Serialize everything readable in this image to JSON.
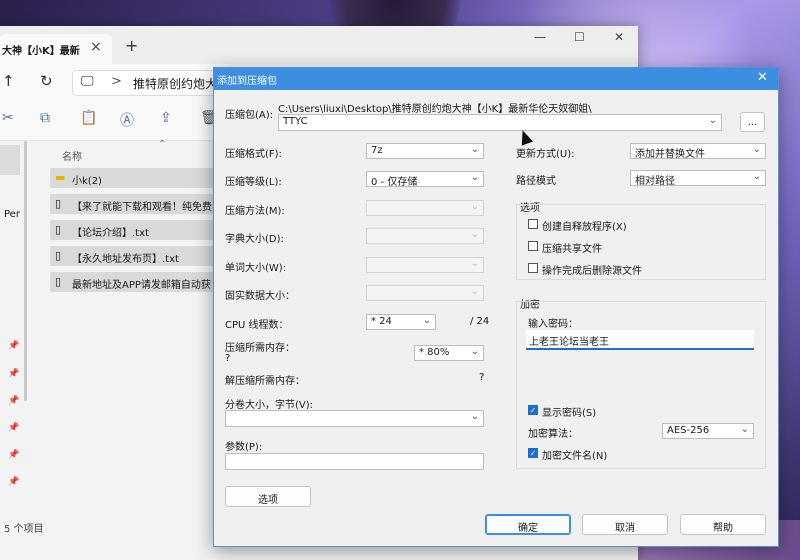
{
  "explorer": {
    "tab_title": "大神【小K】最新",
    "tab_close": "×",
    "new_tab": "+",
    "window_controls": [
      "—",
      "☐",
      "✕"
    ],
    "address_path": "推特原创约炮大神",
    "address_sep": ">",
    "sidebar_label": "Per",
    "column_header": "名称",
    "files": [
      {
        "name": "小k(2)",
        "icon": "folder-icon"
      },
      {
        "name": "【来了就能下载和观看！纯免费",
        "icon": "file-icon"
      },
      {
        "name": "【论坛介绍】.txt",
        "icon": "file-icon"
      },
      {
        "name": "【永久地址发布页】.txt",
        "icon": "file-icon"
      },
      {
        "name": "最新地址及APP请发邮箱自动获",
        "icon": "file-icon"
      }
    ],
    "status": "5 个项目"
  },
  "dialog": {
    "title": "添加到压缩包",
    "archive_label": "压缩包(A):",
    "archive_dir": "C:\\Users\\liuxi\\Desktop\\推特原创约炮大神【小K】最新华伦天奴御姐\\",
    "archive_name": "TTYC",
    "browse_label": "...",
    "format_label": "压缩格式(F):",
    "format_value": "7z",
    "level_label": "压缩等级(L):",
    "level_value": "0 - 仅存储",
    "method_label": "压缩方法(M):",
    "dict_label": "字典大小(D):",
    "word_label": "单词大小(W):",
    "solid_label": "固实数据大小：",
    "cpu_label": "CPU 线程数：",
    "cpu_value": "* 24",
    "cpu_total": "/ 24",
    "mem_label": "压缩所需内存：",
    "mem_q": "?",
    "mem_value": "* 80%",
    "decomp_label": "解压缩所需内存：",
    "decomp_value": "?",
    "split_label": "分卷大小，字节(V):",
    "params_label": "参数(P):",
    "options_button": "选项",
    "update_label": "更新方式(U):",
    "update_value": "添加并替换文件",
    "path_label": "路径模式",
    "path_value": "相对路径",
    "options_group": "选项",
    "opt_sfx": "创建自释放程序(X)",
    "opt_shared": "压缩共享文件",
    "opt_delete": "操作完成后删除源文件",
    "encrypt_group": "加密",
    "password_label": "输入密码：",
    "password_value": "上老王论坛当老王",
    "show_password": "显示密码(S)",
    "enc_method_label": "加密算法：",
    "enc_method_value": "AES-256",
    "enc_names": "加密文件名(N)",
    "ok": "确定",
    "cancel": "取消",
    "help": "帮助"
  }
}
